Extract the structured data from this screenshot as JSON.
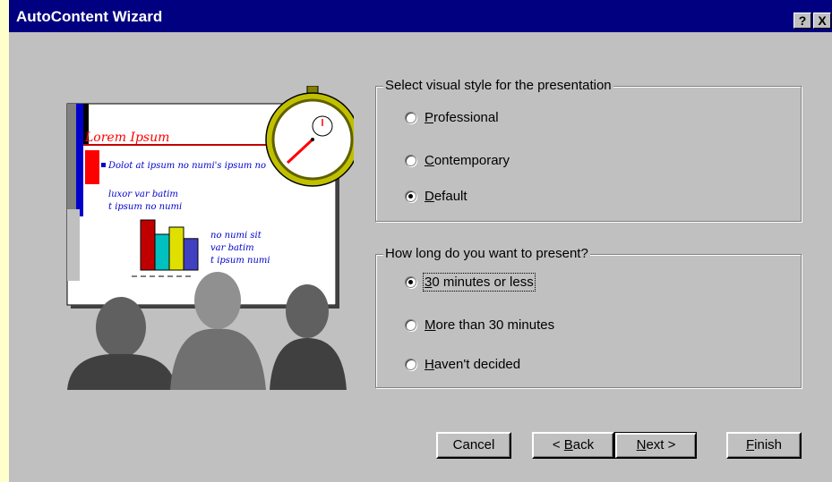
{
  "window": {
    "title": "AutoContent Wizard"
  },
  "titlebar_buttons": {
    "help": "?",
    "close": "X"
  },
  "illustration": {
    "slide_title": "Lorem Ipsum",
    "slide_bullet_main": "Dolot at ipsum no numi's ipsum no",
    "slide_sub_bullets": [
      "luxor var batim",
      "t ipsum no numi"
    ],
    "slide_chart_bullets": [
      "no numi sit",
      "var batim",
      "t ipsum numi"
    ],
    "chart_values": [
      3.5,
      2.5,
      3,
      2.2
    ],
    "chart_colors": [
      "#c00000",
      "#00c0c0",
      "#e0e000",
      "#4040c0"
    ],
    "icons": [
      "stopwatch-icon",
      "audience-icon"
    ]
  },
  "style_group": {
    "title": "Select visual style for the presentation",
    "options": [
      {
        "label": "Professional",
        "mnemonic": "P",
        "rest": "rofessional",
        "selected": false
      },
      {
        "label": "Contemporary",
        "mnemonic": "C",
        "rest": "ontemporary",
        "selected": false
      },
      {
        "label": "Default",
        "mnemonic": "D",
        "rest": "efault",
        "selected": true
      }
    ]
  },
  "duration_group": {
    "title": "How long do you want to present?",
    "options": [
      {
        "label": "30 minutes or less",
        "mnemonic": "3",
        "rest": "0 minutes or less",
        "selected": true
      },
      {
        "label": "More than 30 minutes",
        "mnemonic": "M",
        "rest": "ore than 30 minutes",
        "selected": false
      },
      {
        "label": "Haven't decided",
        "mnemonic": "H",
        "rest": "aven't decided",
        "selected": false
      }
    ]
  },
  "buttons": {
    "cancel": "Cancel",
    "back_prefix": "< ",
    "back_mnemonic": "B",
    "back_rest": "ack",
    "next_mnemonic": "N",
    "next_rest": "ext >",
    "finish_mnemonic": "F",
    "finish_rest": "inish"
  }
}
